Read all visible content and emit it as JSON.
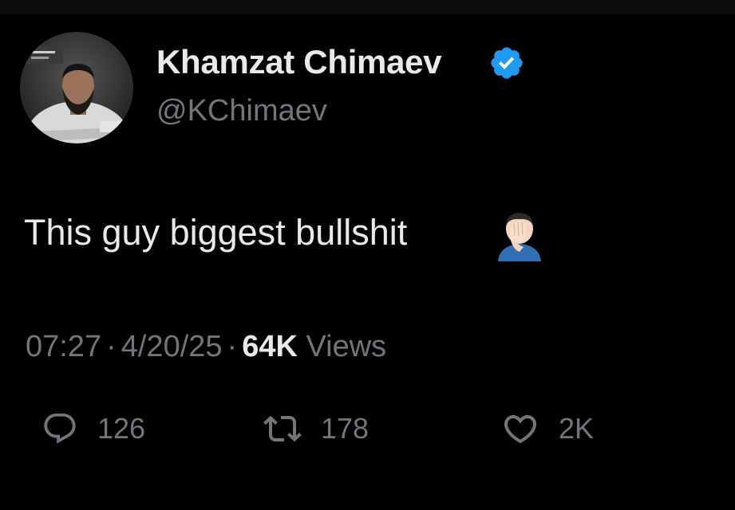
{
  "tweet": {
    "author": {
      "display_name": "Khamzat Chimaev",
      "handle": "@KChimaev",
      "verified": true,
      "avatar_icon": "profile-photo"
    },
    "text": "This guy biggest bullshit",
    "emoji_icon": "man-facepalming-icon",
    "meta": {
      "time": "07:27",
      "date": "4/20/25",
      "views_count": "64K",
      "views_label": "Views"
    },
    "actions": {
      "replies": "126",
      "reposts": "178",
      "likes": "2K"
    }
  },
  "colors": {
    "background": "#000000",
    "primary_text": "#e7e9ea",
    "secondary_text": "#71767b",
    "verified_blue": "#1d9bf0"
  }
}
